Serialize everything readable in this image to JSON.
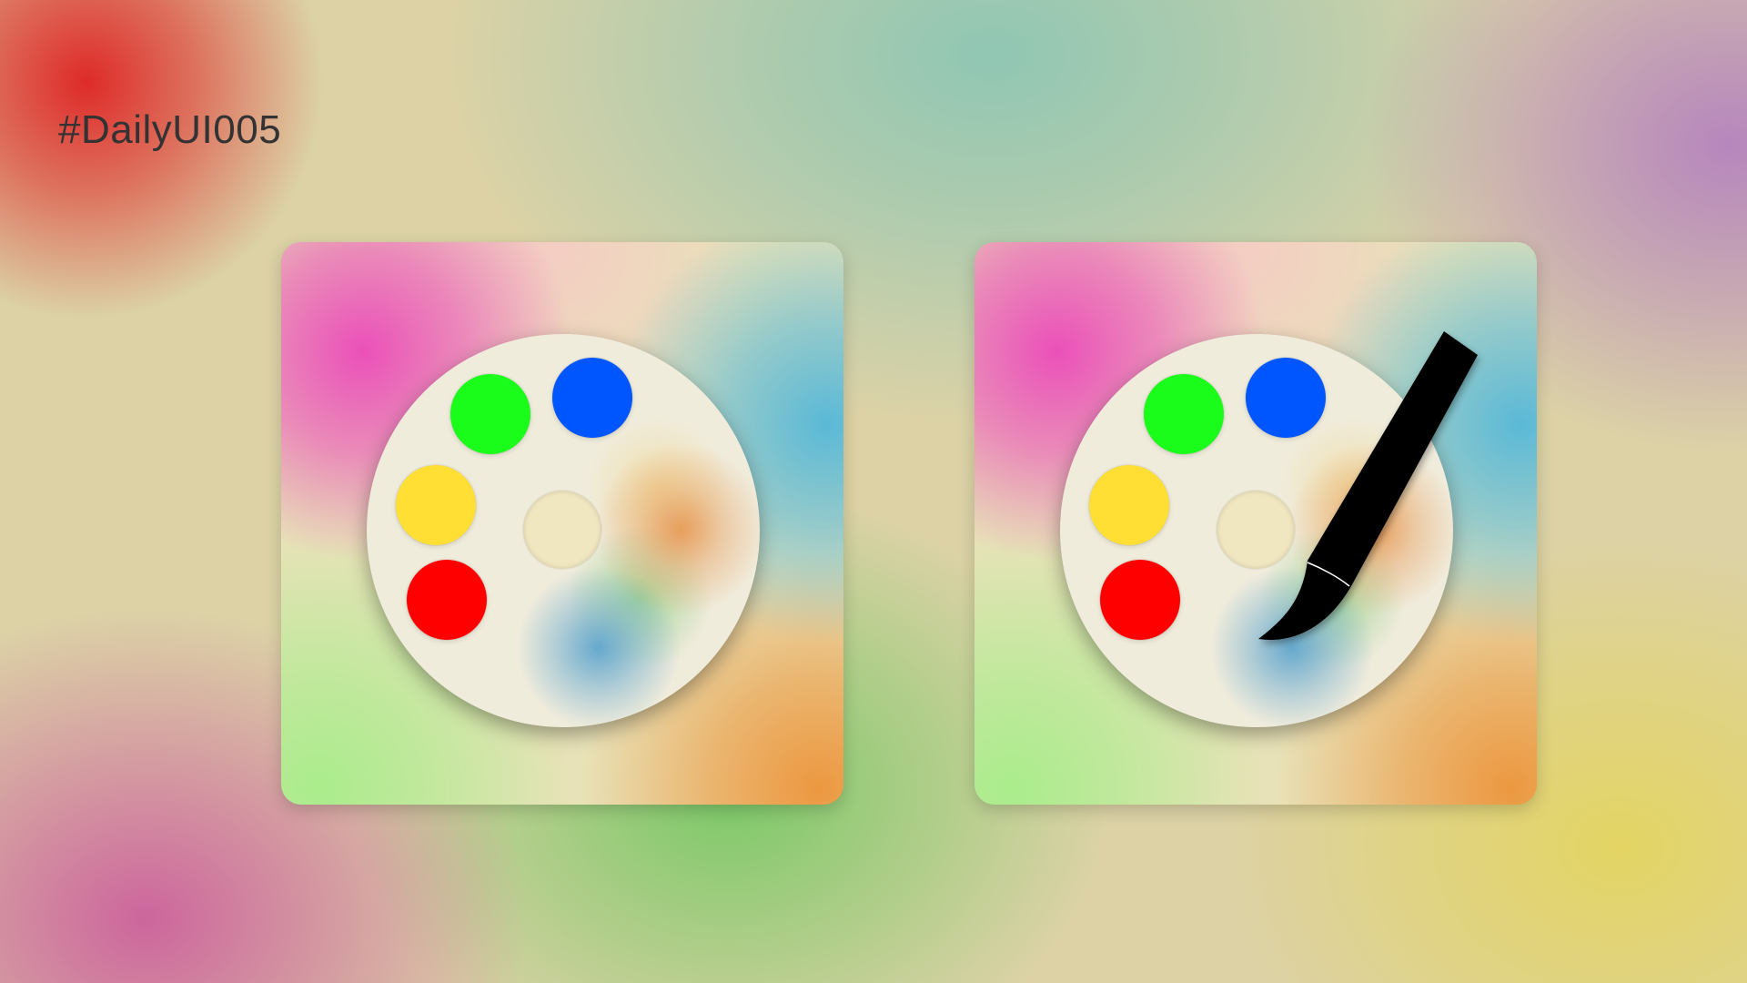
{
  "page": {
    "title": "#DailyUI005"
  },
  "icons": [
    {
      "name": "palette-app-icon",
      "has_brush": false
    },
    {
      "name": "palette-with-brush-app-icon",
      "has_brush": true
    }
  ],
  "colors": {
    "paint_green": "#1afc1a",
    "paint_blue": "#0056fe",
    "paint_yellow": "#ffdf33",
    "paint_red": "#ff0000",
    "center_well": "#f0e6c0",
    "palette_surface": "#f0ecdc",
    "brush": "#000000",
    "title_text": "#333333"
  }
}
